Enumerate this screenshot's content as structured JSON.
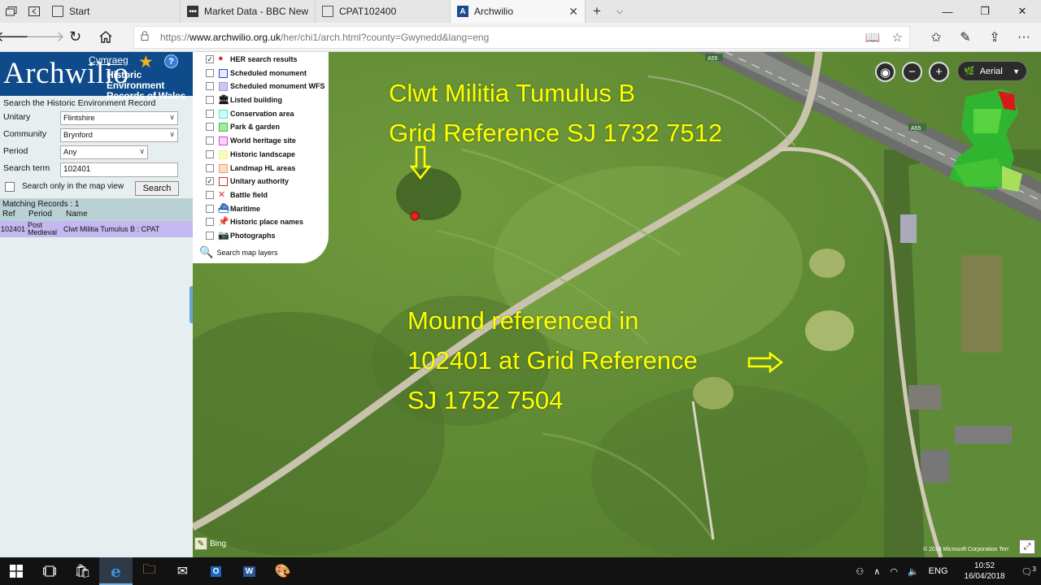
{
  "browser": {
    "tabs": [
      {
        "label": "Start",
        "icon": "start-page-icon",
        "active": false
      },
      {
        "label": "Market Data - BBC News",
        "icon": "bbc-icon",
        "active": false
      },
      {
        "label": "CPAT102400",
        "icon": "page-icon",
        "active": false
      },
      {
        "label": "Archwilio",
        "icon": "archwilio-icon",
        "active": true
      }
    ],
    "url_prefix": "https://",
    "url_host": "www.archwilio.org.uk",
    "url_path": "/her/chi1/arch.html?county=Gwynedd&lang=eng"
  },
  "panel": {
    "logo_title": "Archwilio",
    "logo_sub": [
      "Historic Environment",
      "Records of Wales"
    ],
    "language_link": "Cymraeg",
    "search_title": "Search the Historic Environment Record",
    "fields": {
      "unitary_label": "Unitary",
      "unitary_value": "Flintshire",
      "community_label": "Community",
      "community_value": "Brynford",
      "period_label": "Period",
      "period_value": "Any",
      "term_label": "Search term",
      "term_value": "102401"
    },
    "map_view_label": "Search only in the map view",
    "search_button": "Search",
    "matching": "Matching Records : 1",
    "columns": [
      "Ref",
      "Period",
      "Name"
    ],
    "rows": [
      {
        "ref": "102401",
        "period_1": "Post",
        "period_2": "Medieval",
        "name": "Clwt Militia Tumulus B : CPAT"
      }
    ]
  },
  "layers": [
    {
      "label": "HER search results",
      "checked": true,
      "swatch": "her-results-icon"
    },
    {
      "label": "Scheduled monument",
      "checked": false,
      "swatch": "#2a49c8"
    },
    {
      "label": "Scheduled monument WFS",
      "checked": false,
      "swatch": "#9a9ad6"
    },
    {
      "label": "Listed building",
      "checked": false,
      "swatch": "listed-building-icon"
    },
    {
      "label": "Conservation area",
      "checked": false,
      "swatch": "#3ee8e0"
    },
    {
      "label": "Park & garden",
      "checked": false,
      "swatch": "#3fc43f"
    },
    {
      "label": "World heritage site",
      "checked": false,
      "swatch": "#d640d6"
    },
    {
      "label": "Historic landscape",
      "checked": false,
      "swatch": "#f0f07a"
    },
    {
      "label": "Landmap HL areas",
      "checked": false,
      "swatch": "#f0a060"
    },
    {
      "label": "Unitary authority",
      "checked": true,
      "swatch": "#c83232"
    },
    {
      "label": "Battle field",
      "checked": false,
      "swatch": "battle-field-icon"
    },
    {
      "label": "Maritime",
      "checked": false,
      "swatch": "maritime-icon"
    },
    {
      "label": "Historic place names",
      "checked": false,
      "swatch": "place-name-icon"
    },
    {
      "label": "Photographs",
      "checked": false,
      "swatch": "camera-icon"
    }
  ],
  "search_layers_label": "Search map layers",
  "map": {
    "style_label": "Aerial",
    "road_a": "A55",
    "road_b": "A55",
    "attribution": "Bing",
    "copyright": "© 2018 Microsoft Corporation  Terr"
  },
  "annotations": {
    "a_line1": "Clwt Militia Tumulus B",
    "a_line2": "Grid Reference SJ 1732 7512",
    "b_line1": "Mound referenced in",
    "b_line2": "102401 at Grid Reference",
    "b_line3": "SJ 1752 7504"
  },
  "taskbar": {
    "language": "ENG",
    "time": "10:52",
    "date": "16/04/2018",
    "notifications": "3"
  }
}
